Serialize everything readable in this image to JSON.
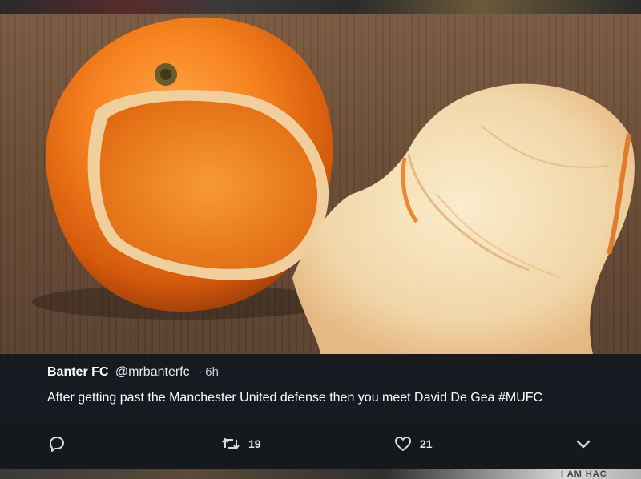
{
  "tweet": {
    "author_name": "Banter FC",
    "author_handle": "@mrbanterfc",
    "time": "· 6h",
    "text": "After getting past the Manchester United defense then you meet David De Gea #MUFC"
  },
  "actions": {
    "reply": {
      "icon": "reply-icon"
    },
    "retweet": {
      "icon": "retweet-icon",
      "count": "19"
    },
    "like": {
      "icon": "heart-icon",
      "count": "21"
    },
    "more": {
      "icon": "chevron-down-icon"
    }
  },
  "background_strip_text": "I AM HAC",
  "colors": {
    "orange": "#f07a1a",
    "peel_inner": "#f3dcb3",
    "overlay": "#181c22"
  }
}
